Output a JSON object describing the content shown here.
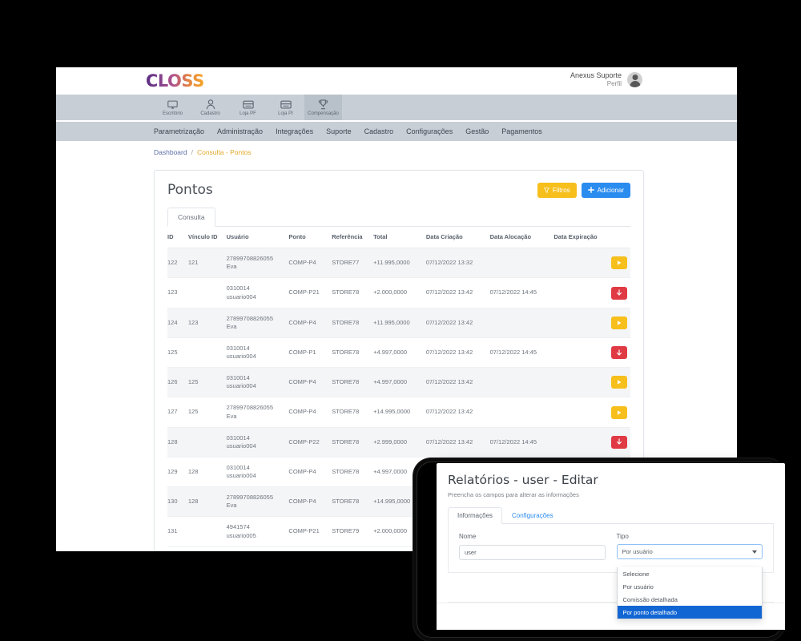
{
  "header": {
    "logo_text": "CLOSS",
    "user_name": "Anexus Suporte",
    "user_role": "Perfil",
    "avatar_icon": "user-avatar-icon"
  },
  "icon_nav": [
    {
      "label": "Escritório",
      "icon": "monitor-icon",
      "active": false
    },
    {
      "label": "Cadastro",
      "icon": "person-icon",
      "active": false
    },
    {
      "label": "Loja PF",
      "icon": "store-icon",
      "active": false
    },
    {
      "label": "Loja PI",
      "icon": "store-icon",
      "active": false
    },
    {
      "label": "Compensação",
      "icon": "trophy-icon",
      "active": true
    }
  ],
  "menu": [
    "Parametrização",
    "Administração",
    "Integrações",
    "Suporte",
    "Cadastro",
    "Configurações",
    "Gestão",
    "Pagamentos"
  ],
  "breadcrumb": {
    "home": "Dashboard",
    "separator": "/",
    "current": "Consulta - Pontos"
  },
  "card": {
    "title": "Pontos",
    "filter_button": "Filtros",
    "filter_icon": "funnel-icon",
    "add_button": "Adicionar",
    "add_icon": "plus-icon",
    "tab": "Consulta"
  },
  "table": {
    "columns": [
      "ID",
      "Vínculo ID",
      "Usuário",
      "Ponto",
      "Referência",
      "Total",
      "Data Criação",
      "Data Alocação",
      "Data Expiração",
      ""
    ],
    "rows": [
      {
        "id": "122",
        "vinculo": "121",
        "user_id": "27899708826055",
        "user_name": "Eva",
        "ponto": "COMP-P4",
        "referencia": "STORE77",
        "total": "+11.995,0000",
        "data_criacao": "07/12/2022 13:32",
        "data_alocacao": "",
        "data_expiracao": "",
        "action": "play",
        "action_icon": "play-icon"
      },
      {
        "id": "123",
        "vinculo": "",
        "user_id": "0310014",
        "user_name": "usuario004",
        "ponto": "COMP-P21",
        "referencia": "STORE78",
        "total": "+2.000,0000",
        "data_criacao": "07/12/2022 13:42",
        "data_alocacao": "07/12/2022 14:45",
        "data_expiracao": "",
        "action": "down",
        "action_icon": "arrow-down-icon"
      },
      {
        "id": "124",
        "vinculo": "123",
        "user_id": "27899708826055",
        "user_name": "Eva",
        "ponto": "COMP-P4",
        "referencia": "STORE78",
        "total": "+11.995,0000",
        "data_criacao": "07/12/2022 13:42",
        "data_alocacao": "",
        "data_expiracao": "",
        "action": "play",
        "action_icon": "play-icon"
      },
      {
        "id": "125",
        "vinculo": "",
        "user_id": "0310014",
        "user_name": "usuario004",
        "ponto": "COMP-P1",
        "referencia": "STORE78",
        "total": "+4.997,0000",
        "data_criacao": "07/12/2022 13:42",
        "data_alocacao": "07/12/2022 14:45",
        "data_expiracao": "",
        "action": "down",
        "action_icon": "arrow-down-icon"
      },
      {
        "id": "126",
        "vinculo": "125",
        "user_id": "0310014",
        "user_name": "usuario004",
        "ponto": "COMP-P4",
        "referencia": "STORE78",
        "total": "+4.997,0000",
        "data_criacao": "07/12/2022 13:42",
        "data_alocacao": "",
        "data_expiracao": "",
        "action": "play",
        "action_icon": "play-icon"
      },
      {
        "id": "127",
        "vinculo": "125",
        "user_id": "27899708826055",
        "user_name": "Eva",
        "ponto": "COMP-P4",
        "referencia": "STORE78",
        "total": "+14.995,0000",
        "data_criacao": "07/12/2022 13:42",
        "data_alocacao": "",
        "data_expiracao": "",
        "action": "play",
        "action_icon": "play-icon"
      },
      {
        "id": "128",
        "vinculo": "",
        "user_id": "0310014",
        "user_name": "usuario004",
        "ponto": "COMP-P22",
        "referencia": "STORE78",
        "total": "+2.999,0000",
        "data_criacao": "07/12/2022 13:42",
        "data_alocacao": "07/12/2022 14:45",
        "data_expiracao": "",
        "action": "down",
        "action_icon": "arrow-down-icon"
      },
      {
        "id": "129",
        "vinculo": "128",
        "user_id": "0310014",
        "user_name": "usuario004",
        "ponto": "COMP-P4",
        "referencia": "STORE78",
        "total": "+4.997,0000",
        "data_criacao": "",
        "data_alocacao": "",
        "data_expiracao": "",
        "action": "",
        "action_icon": ""
      },
      {
        "id": "130",
        "vinculo": "128",
        "user_id": "27899708826055",
        "user_name": "Eva",
        "ponto": "COMP-P4",
        "referencia": "STORE78",
        "total": "+14.995,0000",
        "data_criacao": "",
        "data_alocacao": "",
        "data_expiracao": "",
        "action": "",
        "action_icon": ""
      },
      {
        "id": "131",
        "vinculo": "",
        "user_id": "4941574",
        "user_name": "usuario005",
        "ponto": "COMP-P21",
        "referencia": "STORE79",
        "total": "+2.000,0000",
        "data_criacao": "",
        "data_alocacao": "",
        "data_expiracao": "",
        "action": "",
        "action_icon": ""
      }
    ]
  },
  "modal": {
    "title": "Relatórios - user - Editar",
    "subtitle": "Preencha os campos para alterar as informações",
    "tabs": [
      {
        "label": "Informações",
        "active": true
      },
      {
        "label": "Configurações",
        "active": false
      }
    ],
    "fields": {
      "name_label": "Nome",
      "name_value": "user",
      "type_label": "Tipo",
      "type_value": "Por usuário"
    },
    "dropdown": {
      "open": true,
      "options": [
        {
          "label": "Selecione",
          "selected": false
        },
        {
          "label": "Por usuário",
          "selected": false
        },
        {
          "label": "Comissão detalhada",
          "selected": false
        },
        {
          "label": "Por ponto detalhado",
          "selected": true
        }
      ]
    }
  },
  "colors": {
    "accent_blue": "#2b8cf0",
    "accent_yellow": "#f6bf1c",
    "accent_red": "#e03a45",
    "navbar": "#c7ced6",
    "dropdown_highlight": "#1266d4",
    "breadcrumb_current": "#e3a82a"
  }
}
